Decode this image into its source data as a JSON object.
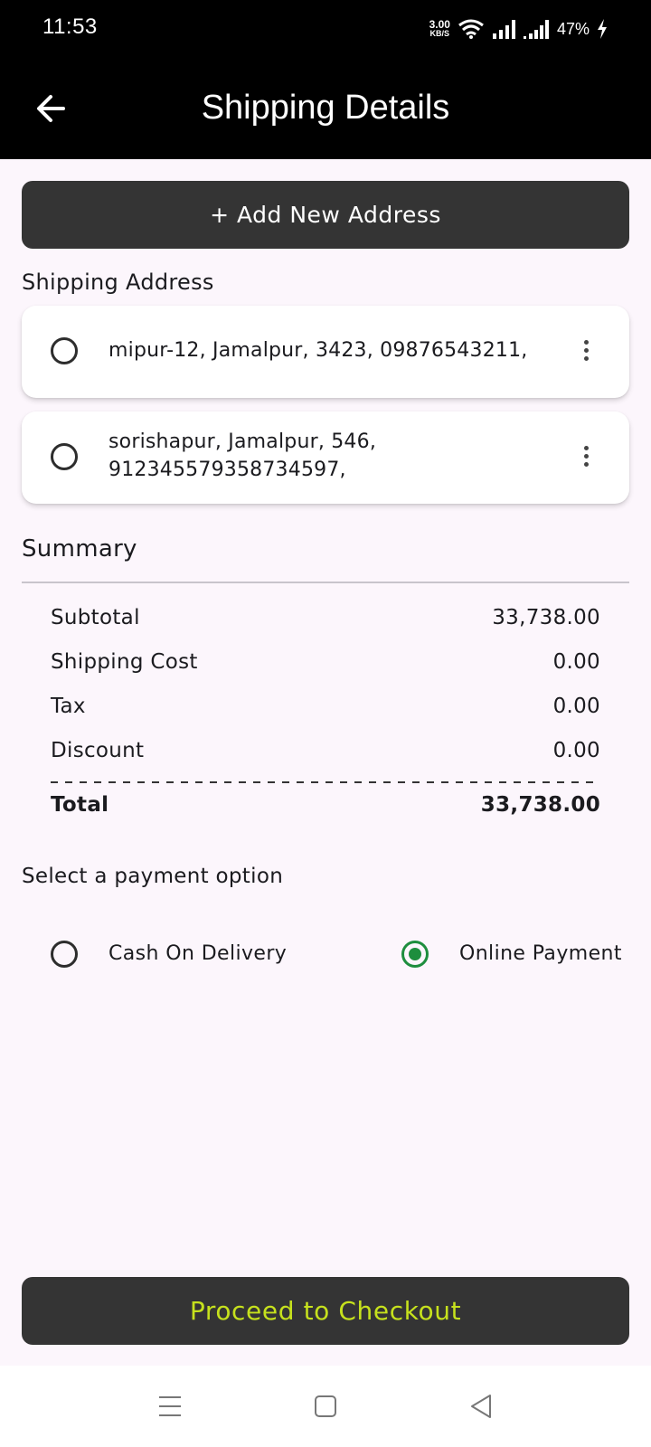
{
  "status_bar": {
    "time": "11:53",
    "net_speed_value": "3.00",
    "net_speed_unit": "KB/S",
    "battery": "47%"
  },
  "app_bar": {
    "title": "Shipping Details",
    "back_icon": "arrow-left-icon"
  },
  "add_address_button": "+ Add New Address",
  "shipping_address_label": "Shipping Address",
  "addresses": [
    {
      "text": "mipur-12, Jamalpur, 3423, 09876543211,",
      "selected": false
    },
    {
      "text": "sorishapur, Jamalpur, 546, 912345579358734597,",
      "selected": false
    }
  ],
  "summary": {
    "title": "Summary",
    "rows": [
      {
        "label": "Subtotal",
        "value": "33,738.00"
      },
      {
        "label": "Shipping Cost",
        "value": "0.00"
      },
      {
        "label": "Tax",
        "value": "0.00"
      },
      {
        "label": "Discount",
        "value": "0.00"
      }
    ],
    "total_label": "Total",
    "total_value": "33,738.00"
  },
  "payment": {
    "title": "Select a payment option",
    "options": [
      {
        "label": "Cash On Delivery",
        "selected": false
      },
      {
        "label": "Online Payment",
        "selected": true
      }
    ]
  },
  "checkout_button": "Proceed to Checkout",
  "colors": {
    "accent_text": "#c6e11d",
    "selected_radio": "#1e8e3e",
    "button_bg": "#343434",
    "page_bg": "#fcf6fc"
  },
  "nav_bar": {
    "icons": [
      "menu-icon",
      "home-square-icon",
      "back-triangle-icon"
    ]
  }
}
